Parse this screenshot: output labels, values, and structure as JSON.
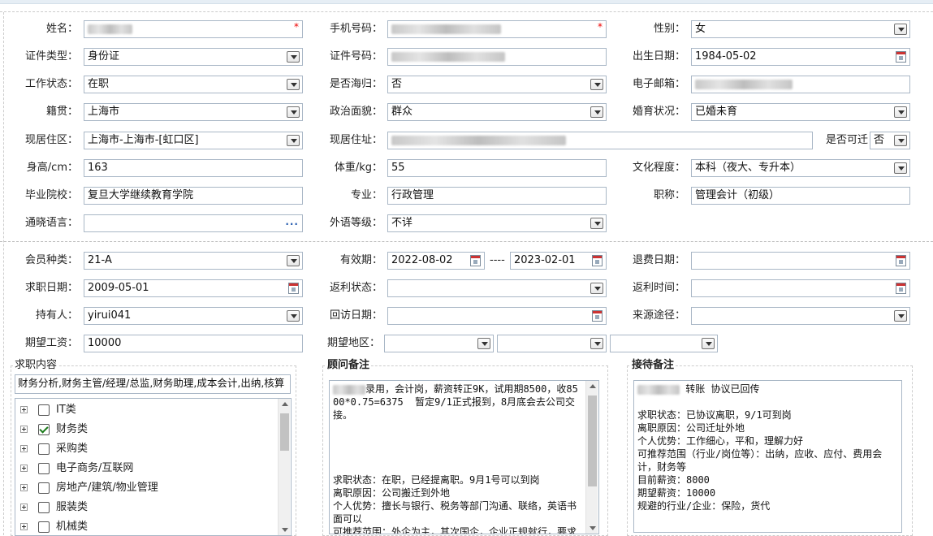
{
  "colors": {
    "required": "#e00000",
    "border": "#a9b7c6",
    "accent_blue": "#2a5fb0"
  },
  "profile": {
    "name": {
      "label": "姓名：",
      "value": ""
    },
    "phone": {
      "label": "手机号码：",
      "value": ""
    },
    "gender": {
      "label": "性别：",
      "value": "女"
    },
    "id_type": {
      "label": "证件类型：",
      "value": "身份证"
    },
    "id_no": {
      "label": "证件号码：",
      "value": ""
    },
    "birth": {
      "label": "出生日期：",
      "value": "1984-05-02"
    },
    "work_status": {
      "label": "工作状态：",
      "value": "在职"
    },
    "overseas": {
      "label": "是否海归：",
      "value": "否"
    },
    "email": {
      "label": "电子邮箱：",
      "value": ""
    },
    "native": {
      "label": "籍贯：",
      "value": "上海市"
    },
    "political": {
      "label": "政治面貌：",
      "value": "群众"
    },
    "marital": {
      "label": "婚育状况：",
      "value": "已婚未育"
    },
    "residence_area": {
      "label": "现居住区：",
      "value": "上海市-上海市-[虹口区]"
    },
    "residence_addr": {
      "label": "现居住址：",
      "value": ""
    },
    "relocate": {
      "label": "是否可迁",
      "value": "否"
    },
    "height": {
      "label": "身高/cm：",
      "value": "163"
    },
    "weight": {
      "label": "体重/kg：",
      "value": "55"
    },
    "education": {
      "label": "文化程度：",
      "value": "本科（夜大、专升本）"
    },
    "school": {
      "label": "毕业院校：",
      "value": "复旦大学继续教育学院"
    },
    "major": {
      "label": "专业：",
      "value": "行政管理"
    },
    "title": {
      "label": "职称：",
      "value": "管理会计（初级）"
    },
    "language": {
      "label": "通晓语言：",
      "value": "",
      "ellipsis": "···"
    },
    "foreign_level": {
      "label": "外语等级：",
      "value": "不详"
    }
  },
  "membership": {
    "member_type": {
      "label": "会员种类：",
      "value": "21-A"
    },
    "valid": {
      "label": "有效期：",
      "from": "2022-08-02",
      "sep": "----",
      "to": "2023-02-01"
    },
    "refund_date": {
      "label": "退费日期：",
      "value": ""
    },
    "job_date": {
      "label": "求职日期：",
      "value": "2009-05-01"
    },
    "rebate_status": {
      "label": "返利状态：",
      "value": ""
    },
    "rebate_time": {
      "label": "返利时间：",
      "value": ""
    },
    "holder": {
      "label": "持有人：",
      "value": "yirui041"
    },
    "visit_date": {
      "label": "回访日期：",
      "value": ""
    },
    "source": {
      "label": "来源途径：",
      "value": ""
    },
    "salary": {
      "label": "期望工资：",
      "value": "10000"
    },
    "region": {
      "label": "期望地区："
    }
  },
  "job_content": {
    "title": "求职内容",
    "selected_text": "财务分析,财务主管/经理/总监,财务助理,成本会计,出纳,核算",
    "tree": [
      {
        "label": "IT类",
        "checked": false
      },
      {
        "label": "财务类",
        "checked": true
      },
      {
        "label": "采购类",
        "checked": false
      },
      {
        "label": "电子商务/互联网",
        "checked": false
      },
      {
        "label": "房地产/建筑/物业管理",
        "checked": false
      },
      {
        "label": "服装类",
        "checked": false
      },
      {
        "label": "机械类",
        "checked": false
      }
    ]
  },
  "consultant_note": {
    "title": "顾问备注",
    "text": "录用，会计岗，薪资转正9K，试用期8500，收8500*0.75=6375  暂定9/1正式报到，8月底会去公司交接。\n\n\n\n\n求职状态：在职，已经提离职。9月1号可以到岗\n离职原因：公司搬迁到外地\n个人优势：擅长与银行、税务等部门沟通、联络，英语书面可以\n可推荐范围：外企为主，其次国企，企业正规就行，要求含额完全，无论招聘公司出纳也可以的，其他以"
  },
  "reception_note": {
    "title": "接待备注",
    "text": "转账 协议已回传\n\n求职状态：已协议离职，9/1可到岗\n离职原因：公司迁址外地\n个人优势：工作细心，平和，理解力好\n可推荐范围（行业/岗位等）：出纳，应收、应付、费用会计，财务等\n目前薪资：8000\n期望薪资：10000\n规避的行业/企业：保险，货代"
  }
}
